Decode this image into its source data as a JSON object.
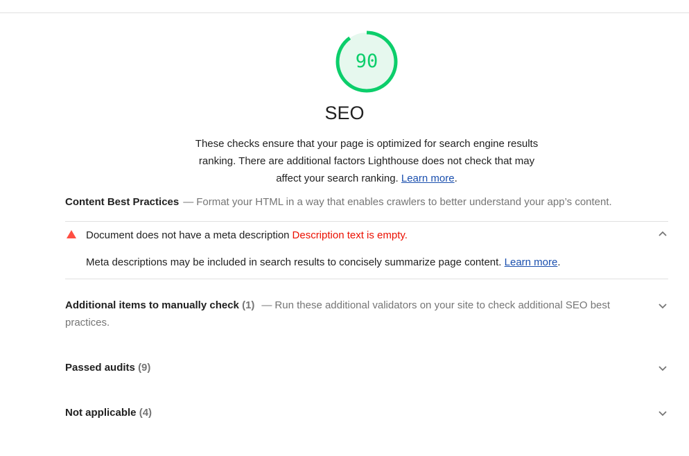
{
  "gauge": {
    "score": "90",
    "fraction": 0.9,
    "color": "#0cce6b",
    "bg": "#e6f8ee"
  },
  "category": {
    "title": "SEO",
    "description": "These checks ensure that your page is optimized for search engine results ranking. There are additional factors Lighthouse does not check that may affect your search ranking.",
    "learn_more": "Learn more",
    "period": "."
  },
  "content_group": {
    "title": "Content Best Practices",
    "separator": "—",
    "description": "Format your HTML in a way that enables crawlers to better understand your app’s content."
  },
  "failed_audit": {
    "title": "Document does not have a meta description",
    "display_value": "Description text is empty.",
    "description": "Meta descriptions may be included in search results to concisely summarize page content.",
    "learn_more": "Learn more",
    "period": "."
  },
  "manual": {
    "title": "Additional items to manually check",
    "count": "(1)",
    "separator": "—",
    "description": "Run these additional validators on your site to check additional SEO best practices."
  },
  "passed": {
    "title": "Passed audits",
    "count": "(9)"
  },
  "not_applicable": {
    "title": "Not applicable",
    "count": "(4)"
  },
  "icons": {
    "fail": "warning-triangle-icon",
    "collapse": "chevron-up-icon",
    "expand": "chevron-down-icon"
  }
}
